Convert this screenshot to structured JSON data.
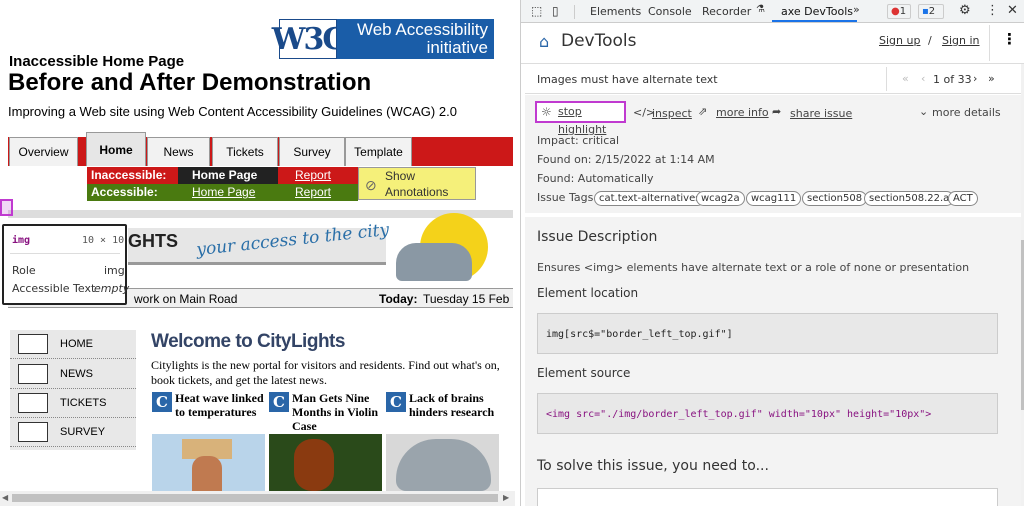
{
  "page": {
    "logo_mark": "W3C",
    "logo_wai_line1": "Web Accessibility",
    "logo_wai_line2": "initiative",
    "title_small": "Inaccessible Home Page",
    "title_big": "Before and After Demonstration",
    "subtitle": "Improving a Web site using Web Content Accessibility Guidelines (WCAG) 2.0",
    "tabs": [
      "Overview",
      "Home",
      "News",
      "Tickets",
      "Survey",
      "Template"
    ],
    "controls": {
      "inaccessible_label": "Inaccessible:",
      "accessible_label": "Accessible:",
      "home_page": "Home Page",
      "home_page_link": "Home Page",
      "report": "Report",
      "report2": "Report",
      "show_annotations": "Show Annotations"
    },
    "banner_text": "GHTS",
    "banner_slogan": "your access to the city",
    "date_left": "work on Main Road",
    "date_label": "Today:",
    "date_value": "Tuesday 15 Feb",
    "menu": [
      "HOME",
      "NEWS",
      "TICKETS",
      "SURVEY"
    ],
    "welcome": "Welcome to CityLights",
    "intro": "Citylights is the new portal for visitors and residents. Find out what's on, book tickets, and get the latest news.",
    "news": [
      {
        "title": "Heat wave linked to temperatures"
      },
      {
        "title": "Man Gets Nine Months in Violin Case"
      },
      {
        "title": "Lack of brains hinders research"
      }
    ],
    "tooltip": {
      "tag": "img",
      "size": "10 × 10",
      "role_label": "Role",
      "role_value": "img",
      "name_label": "Accessible Text",
      "name_value": "empty"
    }
  },
  "devtools": {
    "tabs": [
      "Elements",
      "Console",
      "Recorder",
      "axe DevTools"
    ],
    "more_tabs": "»",
    "errors": "1",
    "messages": "2",
    "axe_title": "DevTools",
    "sign_up": "Sign up",
    "separator": "/",
    "sign_in": "Sign in",
    "issue_title": "Images must have alternate text",
    "pager": "1 of 33",
    "actions": {
      "stop_highlight": "stop highlight",
      "inspect": "inspect",
      "more_info": "more info",
      "share_issue": "share issue",
      "more_details": "more details"
    },
    "impact": "Impact: critical",
    "found_on": "Found on: 2/15/2022 at 1:14 AM",
    "found": "Found: Automatically",
    "tags_label": "Issue Tags:",
    "tags": [
      "cat.text-alternatives",
      "wcag2a",
      "wcag111",
      "section508",
      "section508.22.a",
      "ACT"
    ],
    "issue_description_heading": "Issue Description",
    "issue_description": "Ensures <img> elements have alternate text or a role of none or presentation",
    "element_location_heading": "Element location",
    "element_location": "img[src$=\"border_left_top.gif\"]",
    "element_source_heading": "Element source",
    "element_source": "<img src=\"./img/border_left_top.gif\" width=\"10px\" height=\"10px\">",
    "solve_heading": "To solve this issue, you need to..."
  },
  "colors": {
    "accent": "#1a5da8",
    "tab_red": "#cc1818",
    "inaccessible": "#cc1818",
    "accessible": "#4a7a10",
    "highlight": "#c03ad0"
  }
}
